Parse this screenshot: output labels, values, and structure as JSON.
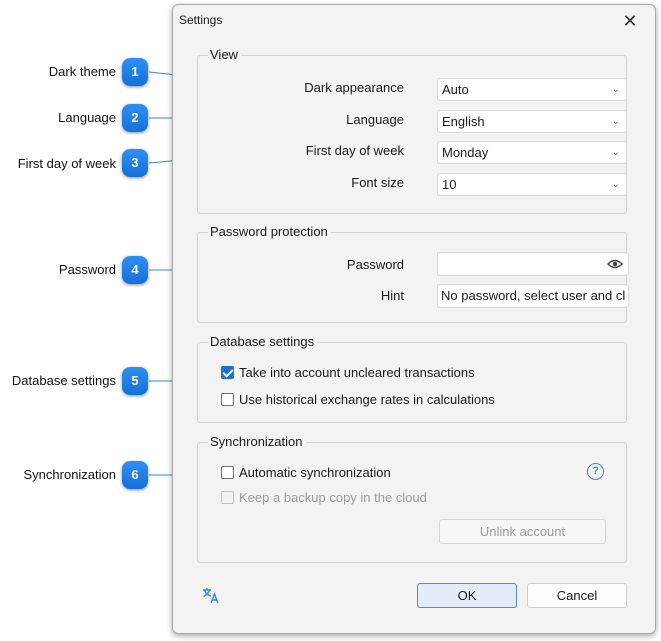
{
  "dialog": {
    "title": "Settings",
    "close_symbol": "✕"
  },
  "view": {
    "title": "View",
    "dark_appearance": {
      "label": "Dark appearance",
      "value": "Auto"
    },
    "language": {
      "label": "Language",
      "value": "English"
    },
    "first_day": {
      "label": "First day of week",
      "value": "Monday"
    },
    "font_size": {
      "label": "Font size",
      "value": "10"
    }
  },
  "password": {
    "title": "Password protection",
    "password_label": "Password",
    "password_value": "",
    "hint_label": "Hint",
    "hint_value": "No password, select user and cl"
  },
  "database": {
    "title": "Database settings",
    "uncleared": {
      "label": "Take into account uncleared transactions",
      "checked": true
    },
    "historical": {
      "label": "Use historical exchange rates in calculations",
      "checked": false
    }
  },
  "sync": {
    "title": "Synchronization",
    "auto": {
      "label": "Automatic synchronization",
      "checked": false
    },
    "backup": {
      "label": "Keep a backup copy in the cloud",
      "checked": false,
      "disabled": true
    },
    "help_symbol": "?",
    "unlink_label": "Unlink account"
  },
  "footer": {
    "ok_label": "OK",
    "cancel_label": "Cancel"
  },
  "annotations": [
    {
      "num": "1",
      "label": "Dark theme"
    },
    {
      "num": "2",
      "label": "Language"
    },
    {
      "num": "3",
      "label": "First day of week"
    },
    {
      "num": "4",
      "label": "Password"
    },
    {
      "num": "5",
      "label": "Database settings"
    },
    {
      "num": "6",
      "label": "Synchronization"
    }
  ],
  "colors": {
    "accent": "#1f6fd0",
    "badge": "#1a7ee6",
    "help": "#3a86d8"
  }
}
